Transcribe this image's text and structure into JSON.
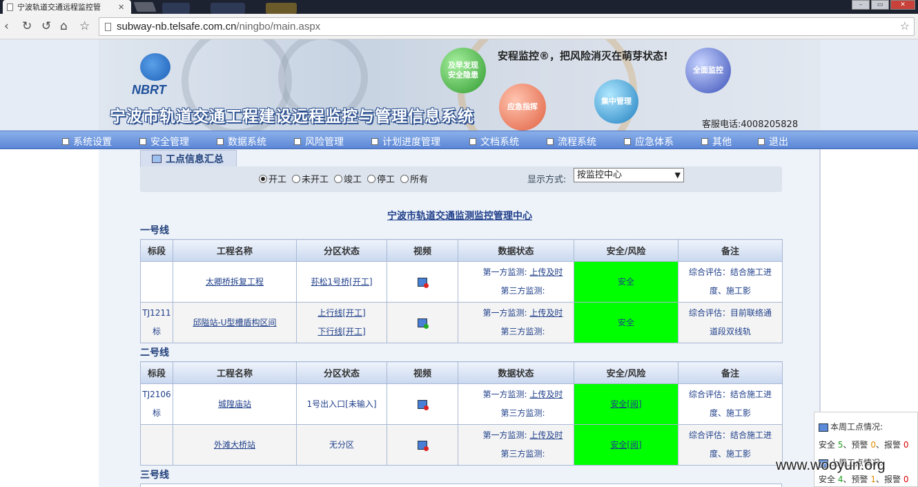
{
  "browser": {
    "tab_title": "宁波轨道交通远程监控管",
    "url_host": "subway-nb.telsafe.com.cn",
    "url_path": "/ningbo/main.aspx"
  },
  "header": {
    "logo_text": "NBRT",
    "system_title": "宁波市轨道交通工程建设远程监控与管理信息系统",
    "slogan": "安程监控®，把风险消灭在萌芽状态!",
    "hotline": "客服电话:4008205828",
    "balls": [
      "及早发现安全隐患",
      "应急指挥",
      "集中管理",
      "全面监控"
    ]
  },
  "nav": {
    "items": [
      "系统设置",
      "安全管理",
      "数据系统",
      "风险管理",
      "计划进度管理",
      "文档系统",
      "流程系统",
      "应急体系",
      "其他",
      "退出"
    ]
  },
  "section": {
    "tab_title": "工点信息汇总"
  },
  "filter": {
    "radios": [
      {
        "label": "开工",
        "checked": true
      },
      {
        "label": "未开工",
        "checked": false
      },
      {
        "label": "竣工",
        "checked": false
      },
      {
        "label": "停工",
        "checked": false
      },
      {
        "label": "所有",
        "checked": false
      }
    ],
    "display_label": "显示方式:",
    "display_value": "按监控中心"
  },
  "center_title": "宁波市轨道交通监测监控管理中心",
  "table_headers": [
    "标段",
    "工程名称",
    "分区状态",
    "视频",
    "数据状态",
    "安全/风险",
    "备注"
  ],
  "lines": [
    {
      "title": "一号线",
      "rows": [
        {
          "section": "",
          "project": "太卿桥拆复工程",
          "zone1": "荪松1号桥[开工]",
          "zone2": "",
          "zone_link": true,
          "video_ok": false,
          "first": "第一方监测:",
          "first_status": "上传及时",
          "third": "第三方监测:",
          "safety": "安全",
          "note": "综合评估：结合施工进度、施工影"
        },
        {
          "section": "TJ1211标",
          "project": "邱隘站-U型槽盾构区间",
          "zone1": "上行线[开工]",
          "zone2": "下行线[开工]",
          "zone_link": true,
          "video_ok": true,
          "first": "第一方监测:",
          "first_status": "上传及时",
          "third": "第三方监测:",
          "safety": "安全",
          "note": "综合评估：目前联络通道段双线轨"
        }
      ]
    },
    {
      "title": "二号线",
      "rows": [
        {
          "section": "TJ2106标",
          "project": "城隍庙站",
          "zone1": "1号出入口[未输入]",
          "zone2": "",
          "zone_link": false,
          "video_ok": false,
          "first": "第一方监测:",
          "first_status": "上传及时",
          "third": "第三方监测:",
          "safety": "安全[阅]",
          "note": "综合评估：结合施工进度、施工影"
        },
        {
          "section": "",
          "project": "外滩大桥站",
          "zone1": "无分区",
          "zone2": "",
          "zone_link": false,
          "video_ok": false,
          "first": "第一方监测:",
          "first_status": "上传及时",
          "third": "第三方监测:",
          "safety": "安全[阅]",
          "note": "综合评估：结合施工进度、施工影"
        }
      ]
    },
    {
      "title": "三号线",
      "rows": []
    }
  ],
  "side_panel": {
    "this_week_label": "本周工点情况:",
    "this_week": {
      "safe_label": "安全",
      "safe": "5",
      "warn_label": "预警",
      "warn": "0",
      "alarm_label": "报警",
      "alarm": "0"
    },
    "last_week_label": "上周工点情况:",
    "last_week": {
      "safe_label": "安全",
      "safe": "4",
      "warn_label": "预警",
      "warn": "1",
      "alarm_label": "报警",
      "alarm": "0"
    }
  },
  "watermark": "www.wooyun.org"
}
